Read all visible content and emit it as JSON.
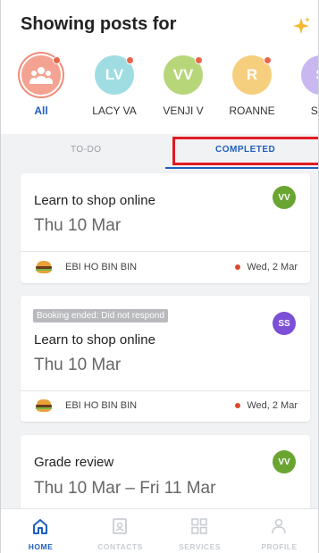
{
  "header": {
    "title": "Showing posts for",
    "sparkle_icon": "sparkle-icon"
  },
  "avatars": [
    {
      "label": "All",
      "initials": "",
      "color": "#f4a292",
      "active": true,
      "dot": true
    },
    {
      "label": "LACY VA",
      "initials": "LV",
      "color": "#9fdde3",
      "dot": true
    },
    {
      "label": "VENJI V",
      "initials": "VV",
      "color": "#b7d67a",
      "dot": true
    },
    {
      "label": "ROANNE",
      "initials": "R",
      "color": "#f6cf7e",
      "dot": true
    },
    {
      "label": "STA",
      "initials": "S",
      "color": "#c9b8f0",
      "dot": false
    }
  ],
  "tabs": {
    "todo": "TO-DO",
    "completed": "COMPLETED",
    "active": "completed"
  },
  "posts": [
    {
      "status": "",
      "title": "Learn to shop online",
      "date": "Thu 10 Mar",
      "avatar": "VV",
      "avatar_color": "#6aa532",
      "author": "EBI HO BIN BIN",
      "meta": "Wed, 2 Mar"
    },
    {
      "status": "Booking ended: Did not respond",
      "title": "Learn to shop online",
      "date": "Thu 10 Mar",
      "avatar": "SS",
      "avatar_color": "#7b4fd6",
      "author": "EBI HO BIN BIN",
      "meta": "Wed, 2 Mar"
    },
    {
      "status": "",
      "title": "Grade review",
      "date": "Thu 10 Mar – Fri 11 Mar",
      "avatar": "VV",
      "avatar_color": "#6aa532"
    }
  ],
  "bottom_nav": [
    {
      "label": "HOME",
      "icon": "home-icon",
      "active": true
    },
    {
      "label": "CONTACTS",
      "icon": "contacts-icon",
      "active": false
    },
    {
      "label": "SERVICES",
      "icon": "services-icon",
      "active": false
    },
    {
      "label": "PROFILE",
      "icon": "profile-icon",
      "active": false
    }
  ]
}
